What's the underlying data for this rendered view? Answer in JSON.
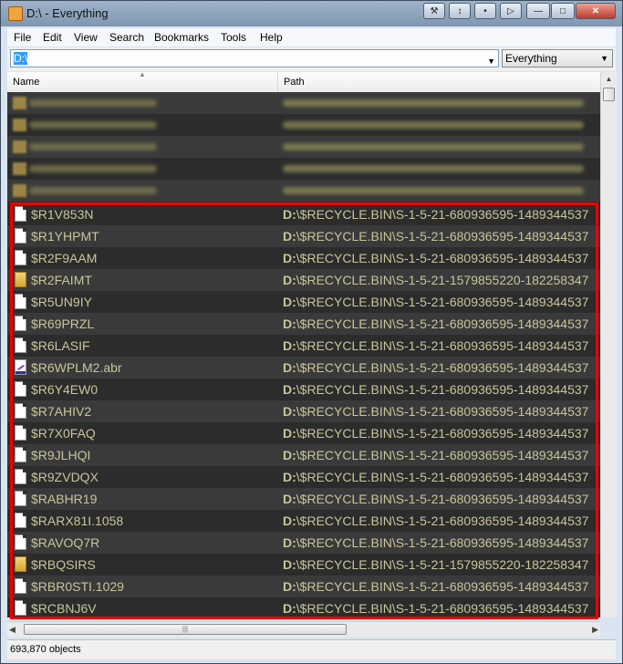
{
  "window": {
    "title": "D:\\ - Everything"
  },
  "titlebar_buttons": [
    "tool-icon",
    "scroll-icon",
    "minimize-icon",
    "pin-icon",
    "minimize",
    "maximize",
    "close"
  ],
  "menu": [
    "File",
    "Edit",
    "View",
    "Search",
    "Bookmarks",
    "Tools",
    "Help"
  ],
  "search": {
    "value": "D:\\"
  },
  "filter": {
    "selected": "Everything"
  },
  "columns": {
    "name": "Name",
    "path": "Path"
  },
  "rows": [
    {
      "icon": "file-icon",
      "name": "$R1V853N",
      "drive": "D:",
      "path": "\\$RECYCLE.BIN\\S-1-5-21-680936595-1489344537"
    },
    {
      "icon": "file-icon",
      "name": "$R1YHPMT",
      "drive": "D:",
      "path": "\\$RECYCLE.BIN\\S-1-5-21-680936595-1489344537"
    },
    {
      "icon": "file-icon",
      "name": "$R2F9AAM",
      "drive": "D:",
      "path": "\\$RECYCLE.BIN\\S-1-5-21-680936595-1489344537"
    },
    {
      "icon": "folder-icon",
      "name": "$R2FAIMT",
      "drive": "D:",
      "path": "\\$RECYCLE.BIN\\S-1-5-21-1579855220-182258347"
    },
    {
      "icon": "file-icon",
      "name": "$R5UN9IY",
      "drive": "D:",
      "path": "\\$RECYCLE.BIN\\S-1-5-21-680936595-1489344537"
    },
    {
      "icon": "file-icon",
      "name": "$R69PRZL",
      "drive": "D:",
      "path": "\\$RECYCLE.BIN\\S-1-5-21-680936595-1489344537"
    },
    {
      "icon": "file-icon",
      "name": "$R6LASIF",
      "drive": "D:",
      "path": "\\$RECYCLE.BIN\\S-1-5-21-680936595-1489344537"
    },
    {
      "icon": "abr-file-icon",
      "name": "$R6WPLM2.abr",
      "drive": "D:",
      "path": "\\$RECYCLE.BIN\\S-1-5-21-680936595-1489344537"
    },
    {
      "icon": "file-icon",
      "name": "$R6Y4EW0",
      "drive": "D:",
      "path": "\\$RECYCLE.BIN\\S-1-5-21-680936595-1489344537"
    },
    {
      "icon": "file-icon",
      "name": "$R7AHIV2",
      "drive": "D:",
      "path": "\\$RECYCLE.BIN\\S-1-5-21-680936595-1489344537"
    },
    {
      "icon": "file-icon",
      "name": "$R7X0FAQ",
      "drive": "D:",
      "path": "\\$RECYCLE.BIN\\S-1-5-21-680936595-1489344537"
    },
    {
      "icon": "file-icon",
      "name": "$R9JLHQI",
      "drive": "D:",
      "path": "\\$RECYCLE.BIN\\S-1-5-21-680936595-1489344537"
    },
    {
      "icon": "file-icon",
      "name": "$R9ZVDQX",
      "drive": "D:",
      "path": "\\$RECYCLE.BIN\\S-1-5-21-680936595-1489344537"
    },
    {
      "icon": "file-icon",
      "name": "$RABHR19",
      "drive": "D:",
      "path": "\\$RECYCLE.BIN\\S-1-5-21-680936595-1489344537"
    },
    {
      "icon": "file-icon",
      "name": "$RARX81I.1058",
      "drive": "D:",
      "path": "\\$RECYCLE.BIN\\S-1-5-21-680936595-1489344537"
    },
    {
      "icon": "file-icon",
      "name": "$RAVOQ7R",
      "drive": "D:",
      "path": "\\$RECYCLE.BIN\\S-1-5-21-680936595-1489344537"
    },
    {
      "icon": "folder-icon",
      "name": "$RBQSIRS",
      "drive": "D:",
      "path": "\\$RECYCLE.BIN\\S-1-5-21-1579855220-182258347"
    },
    {
      "icon": "file-icon",
      "name": "$RBR0STI.1029",
      "drive": "D:",
      "path": "\\$RECYCLE.BIN\\S-1-5-21-680936595-1489344537"
    },
    {
      "icon": "file-icon",
      "name": "$RCBNJ6V",
      "drive": "D:",
      "path": "\\$RECYCLE.BIN\\S-1-5-21-680936595-1489344537"
    }
  ],
  "status": {
    "count": "693,870 objects"
  },
  "colors": {
    "list_bg": "#2f2f2f",
    "text": "#c8c59a",
    "highlight_border": "#ee0000",
    "selection": "#3399ff"
  }
}
